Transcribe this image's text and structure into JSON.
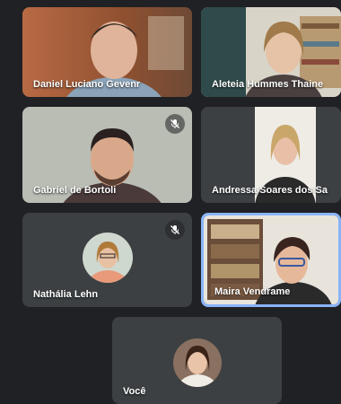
{
  "meeting": {
    "participants": [
      {
        "name": "Daniel Luciano Gevenr",
        "muted": false,
        "is_you": false,
        "speaking": false
      },
      {
        "name": "Aleteia Hummes Thaine",
        "muted": false,
        "is_you": false,
        "speaking": false
      },
      {
        "name": "Gabriel de Bortoli",
        "muted": true,
        "is_you": false,
        "speaking": false
      },
      {
        "name": "Andressa Soares dos Sa",
        "muted": false,
        "is_you": false,
        "speaking": false
      },
      {
        "name": "Nathália Lehn",
        "muted": true,
        "is_you": false,
        "speaking": false
      },
      {
        "name": "Maira Vendrame",
        "muted": false,
        "is_you": false,
        "speaking": true
      },
      {
        "name": "Você",
        "muted": false,
        "is_you": true,
        "speaking": false
      }
    ],
    "colors": {
      "background": "#202124",
      "tile": "#3c4043",
      "active_border": "#8ab4f8",
      "name_text": "#ffffff"
    }
  }
}
